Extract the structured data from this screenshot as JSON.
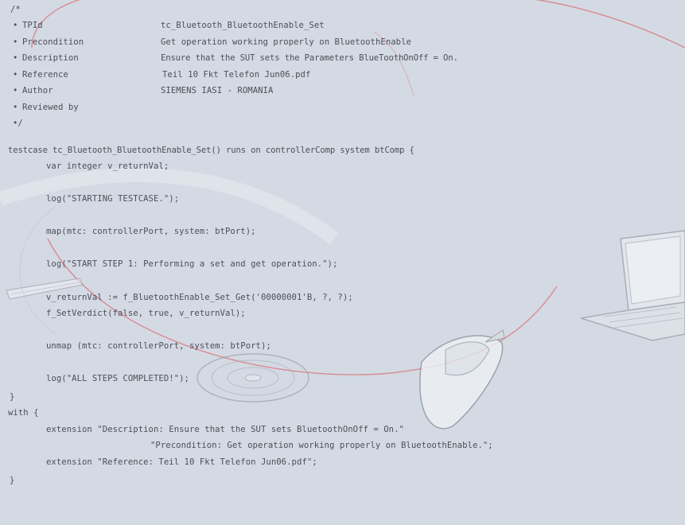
{
  "header_comment": {
    "open": "/*",
    "fields": [
      {
        "bullet": "•",
        "key": "TPId",
        "value": "tc_Bluetooth_BluetoothEnable_Set"
      },
      {
        "bullet": "•",
        "key": "Precondition",
        "value": "Get operation working properly on BluetoothEnable"
      },
      {
        "bullet": "•",
        "key": "Description",
        "value": "Ensure that the SUT sets the Parameters BlueToothOnOff = On."
      },
      {
        "bullet": "•",
        "key": "Reference",
        "value": "Teil 10 Fkt Telefon Jun06.pdf"
      },
      {
        "bullet": "•",
        "key": "Author",
        "value": "SIEMENS IASI - ROMANIA"
      },
      {
        "bullet": "•",
        "key": "Reviewed by",
        "value": ""
      }
    ],
    "close": "•/"
  },
  "testcase": {
    "signature": "testcase tc_Bluetooth_BluetoothEnable_Set() runs on controllerComp system btComp {",
    "var_decl": "var integer v_returnVal;",
    "log_start": "log(\"STARTING TESTCASE.\");",
    "map_stmt": "map(mtc: controllerPort, system: btPort);",
    "log_step1": "log(\"START STEP 1: Performing a set and get operation.\");",
    "assign_stmt": "v_returnVal := f_BluetoothEnable_Set_Get('00000001'B, ?, ?);",
    "verdict_stmt": "f_SetVerdict(false, true, v_returnVal);",
    "unmap_stmt": "unmap (mtc: controllerPort, system: btPort);",
    "log_done": "log(\"ALL STEPS COMPLETED!\");",
    "close_brace": "}"
  },
  "with_block": {
    "open": "with {",
    "ext1_line1": "extension \"Description: Ensure that the SUT sets BluetoothOnOff = On.\"",
    "ext1_line2": "\"Precondition: Get operation working properly on BluetoothEnable.\";",
    "ext2": "extension \"Reference: Teil 10 Fkt Telefon Jun06.pdf\";",
    "close": "}"
  },
  "colors": {
    "background": "#d4dae3",
    "text": "#4b4f58",
    "decor_curve": "#d86a72",
    "decor_shapes": "#eef0f4"
  },
  "decor_icons": [
    "laptop-icon",
    "mobile-phone-icon",
    "disc-icon",
    "pen-icon"
  ]
}
